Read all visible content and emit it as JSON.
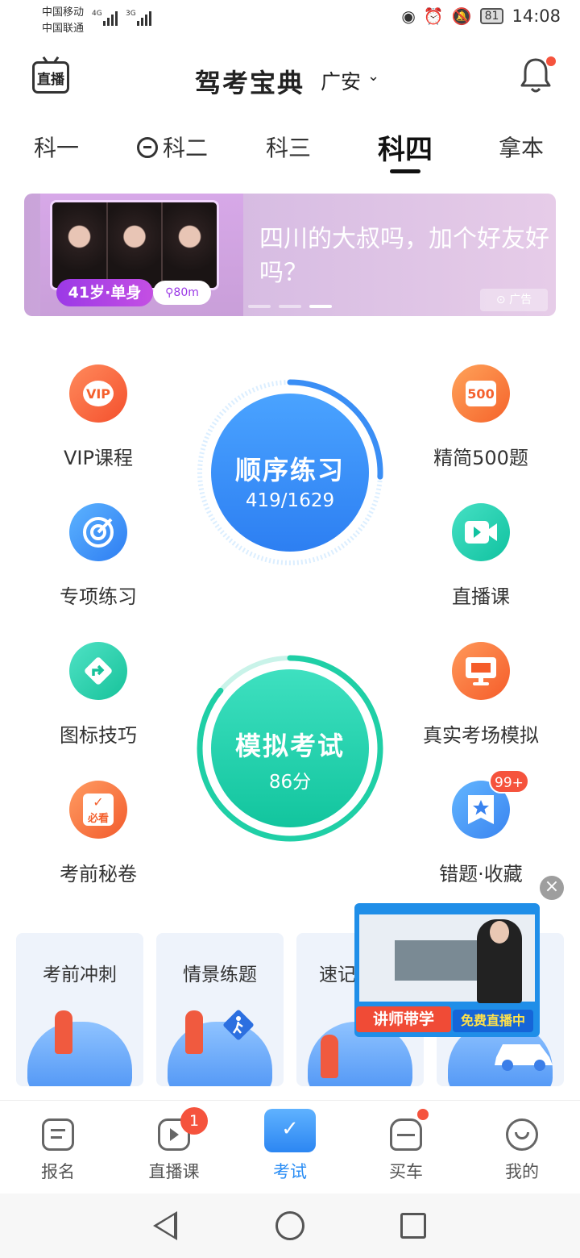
{
  "status_bar": {
    "carrier1": "中国移动",
    "carrier2": "中国联通",
    "net1": "4G",
    "net2": "3G",
    "battery": "81",
    "time": "14:08"
  },
  "header": {
    "live_label": "直播",
    "title": "驾考宝典",
    "city": "广安",
    "chevron": "⌄"
  },
  "tabs": [
    {
      "label": "科一"
    },
    {
      "label": "科二"
    },
    {
      "label": "科三"
    },
    {
      "label": "科四",
      "active": true
    },
    {
      "label": "拿本"
    }
  ],
  "banner": {
    "tag_age": "41岁·单身",
    "tag_distance": "80m",
    "text": "四川的大叔吗，加个好友好吗？",
    "ad_label": "广告",
    "slide_index": 3,
    "slide_count": 3
  },
  "features_left": [
    {
      "label": "VIP课程",
      "icon": "vip-icon"
    },
    {
      "label": "专项练习",
      "icon": "target-icon"
    },
    {
      "label": "图标技巧",
      "icon": "road-sign-icon"
    },
    {
      "label": "考前秘卷",
      "icon": "secret-paper-icon",
      "icon_text": "必看"
    }
  ],
  "features_right": [
    {
      "label": "精简500题",
      "icon": "500-icon",
      "icon_text": "500"
    },
    {
      "label": "直播课",
      "icon": "video-icon"
    },
    {
      "label": "真实考场模拟",
      "icon": "monitor-icon"
    },
    {
      "label": "错题·收藏",
      "icon": "star-badge-icon",
      "badge": "99+"
    }
  ],
  "practice": {
    "title": "顺序练习",
    "progress_text": "419/1629",
    "done": 419,
    "total": 1629,
    "color": "#3a8ef5"
  },
  "exam": {
    "title": "模拟考试",
    "score_text": "86分",
    "score": 86,
    "color": "#1fcfa6"
  },
  "cards": [
    {
      "title": "考前冲刺"
    },
    {
      "title": "情景练题"
    },
    {
      "title": "速记"
    }
  ],
  "floating_video": {
    "tag1": "讲师带学",
    "tag2": "免费直播中"
  },
  "bottom_nav": [
    {
      "label": "报名"
    },
    {
      "label": "直播课",
      "badge": "1"
    },
    {
      "label": "考试",
      "active": true
    },
    {
      "label": "买车",
      "dot": true
    },
    {
      "label": "我的"
    }
  ],
  "colors": {
    "accent": "#2a8df4",
    "badge": "#f5533d"
  }
}
